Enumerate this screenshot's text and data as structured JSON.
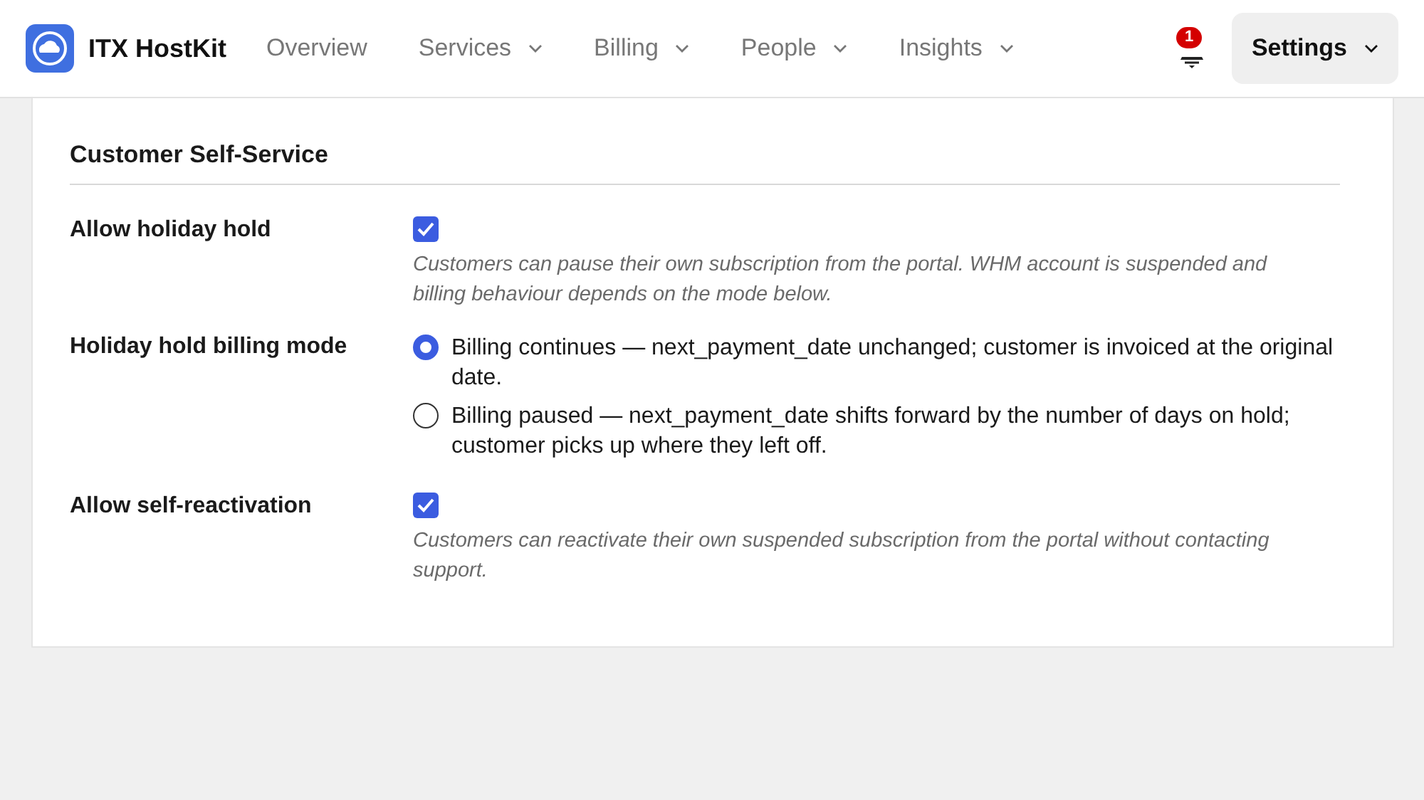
{
  "nav": {
    "brand": "ITX HostKit",
    "items": [
      {
        "label": "Overview",
        "dropdown": false
      },
      {
        "label": "Services",
        "dropdown": true
      },
      {
        "label": "Billing",
        "dropdown": true
      },
      {
        "label": "People",
        "dropdown": true
      },
      {
        "label": "Insights",
        "dropdown": true
      }
    ],
    "notifications": {
      "count": "1"
    },
    "settings": {
      "label": "Settings",
      "selected": true
    }
  },
  "section": {
    "title": "Customer Self-Service",
    "fields": [
      {
        "kind": "checkbox",
        "label": "Allow holiday hold",
        "checked": true,
        "help": "Customers can pause their own subscription from the portal. WHM account is suspended and billing behaviour depends on the mode below."
      },
      {
        "kind": "radio",
        "label": "Holiday hold billing mode",
        "options": [
          {
            "label": "Billing continues — next_payment_date unchanged; customer is invoiced at the original date.",
            "selected": true
          },
          {
            "label": "Billing paused — next_payment_date shifts forward by the number of days on hold; customer picks up where they left off.",
            "selected": false
          }
        ]
      },
      {
        "kind": "checkbox",
        "label": "Allow self-reactivation",
        "checked": true,
        "help": "Customers can reactivate their own suspended subscription from the portal without contacting support."
      }
    ]
  }
}
